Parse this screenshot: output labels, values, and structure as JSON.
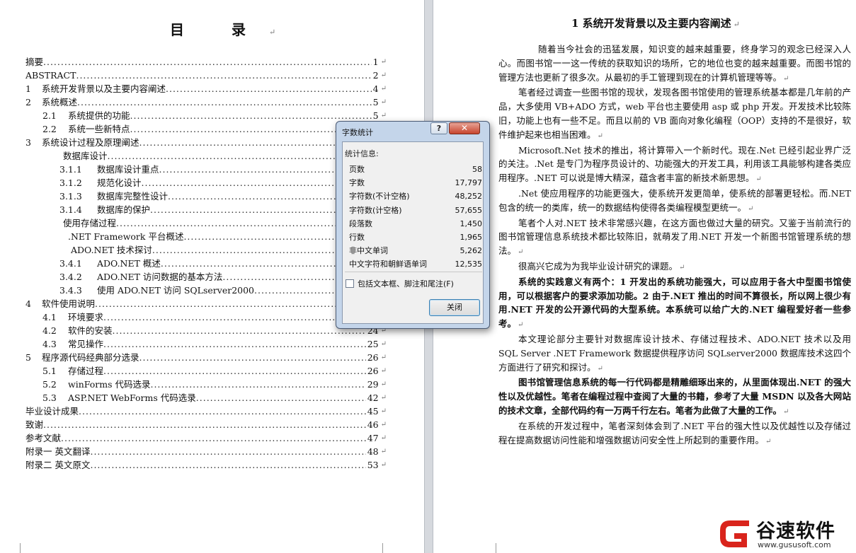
{
  "toc": {
    "title": "目 录",
    "entries": [
      {
        "num": "",
        "text": "摘要",
        "page": "1"
      },
      {
        "num": "",
        "text": "ABSTRACT",
        "page": "2"
      },
      {
        "num": "1",
        "text": "系统开发背景以及主要内容阐述",
        "page": "4"
      },
      {
        "num": "2",
        "text": "系统概述",
        "page": "5"
      },
      {
        "num": "2.1",
        "text": "系统提供的功能",
        "page": "5"
      },
      {
        "num": "2.2",
        "text": "系统一些新特点",
        "page": ""
      },
      {
        "num": "3",
        "text": "系统设计过程及原理阐述",
        "page": ""
      },
      {
        "num": "",
        "text": "数据库设计",
        "page": ""
      },
      {
        "num": "3.1.1",
        "text": "数据库设计重点",
        "page": ""
      },
      {
        "num": "3.1.2",
        "text": "规范化设计",
        "page": ""
      },
      {
        "num": "3.1.3",
        "text": "数据库完整性设计",
        "page": ""
      },
      {
        "num": "3.1.4",
        "text": "数据库的保护",
        "page": ""
      },
      {
        "num": "",
        "text": "使用存储过程",
        "page": ""
      },
      {
        "num": "",
        "text": ".NET Framework 平台概述",
        "page": ""
      },
      {
        "num": "",
        "text": "ADO.NET 技术探讨",
        "page": ""
      },
      {
        "num": "3.4.1",
        "text": "ADO.NET 概述",
        "page": ""
      },
      {
        "num": "3.4.2",
        "text": "ADO.NET 访问数据的基本方法",
        "page": ""
      },
      {
        "num": "3.4.3",
        "text": "使用 ADO.NET 访问 SQLserver2000",
        "page": ""
      },
      {
        "num": "4",
        "text": "软件使用说明",
        "page": ""
      },
      {
        "num": "4.1",
        "text": "环境要求",
        "page": ""
      },
      {
        "num": "4.2",
        "text": "软件的安装",
        "page": "24"
      },
      {
        "num": "4.3",
        "text": "常见操作",
        "page": "25"
      },
      {
        "num": "5",
        "text": "程序源代码经典部分选录",
        "page": "26"
      },
      {
        "num": "5.1",
        "text": "存储过程",
        "page": "26"
      },
      {
        "num": "5.2",
        "text": "winForms 代码选录",
        "page": "29"
      },
      {
        "num": "5.3",
        "text": "ASP.NET WebForms 代码选录",
        "page": "42"
      },
      {
        "num": "",
        "text": "毕业设计成果",
        "page": "45"
      },
      {
        "num": "",
        "text": "致谢",
        "page": "46"
      },
      {
        "num": "",
        "text": "参考文献",
        "page": "47"
      },
      {
        "num": "",
        "text": "附录一 英文翻译",
        "page": "48"
      },
      {
        "num": "",
        "text": "附录二 英文原文",
        "page": "53"
      }
    ]
  },
  "chapter": {
    "title": "1 系统开发背景以及主要内容阐述",
    "paragraphs": [
      {
        "text": "随着当今社会的迅猛发展，知识变的越来越重要，终身学习的观念已经深入人心。而图书馆一一这一传统的获取知识的场所，它的地位也变的越来越重要。而图书馆的管理方法也更新了很多次。从最初的手工管理到现在的计算机管理等等。",
        "bold": false
      },
      {
        "text": "笔者经过调查一些图书馆的现状，发现各图书馆使用的管理系统基本都是几年前的产品，大多使用 VB+ADO 方式，web 平台也主要使用 asp 或 php 开发。开发技术比较陈旧，功能上也有一些不足。而且以前的 VB 面向对象化编程（OOP）支持的不是很好，软件维护起来也相当困难。",
        "bold": false
      },
      {
        "text": "Microsoft.Net 技术的推出，将计算带入一个新时代。现在.Net 已经引起业界广泛的关注。.Net 是专门为程序员设计的、功能强大的开发工具，利用该工具能够构建各类应用程序。.NET 可以说是博大精深，蕴含者丰富的新技术新思想。",
        "bold": false
      },
      {
        "text": ".Net 使应用程序的功能更强大，使系统开发更简单，使系统的部署更轻松。而.NET 包含的统一的类库，统一的数据结构使得各类编程模型更统一。",
        "bold": false
      },
      {
        "text": "笔者个人对.NET 技术非常感兴趣，在这方面也做过大量的研究。又鉴于当前流行的图书馆管理信息系统技术都比较陈旧，就萌发了用.NET 开发一个新图书馆管理系统的想法。",
        "bold": false
      },
      {
        "text": "很高兴它成为为我毕业设计研究的课题。",
        "bold": false
      },
      {
        "text": "系统的实践意义有两个：1 开发出的系统功能强大，可以应用于各大中型图书馆使用，可以根据客户的要求添加功能。2 由于.NET 推出的时间不算很长，所以网上很少有用.NET 开发的公开源代码的大型系统。本系统可以给广大的.NET 编程爱好者一些参考。",
        "bold": true
      },
      {
        "text": "本文理论部分主要针对数据库设计技术、存储过程技术、ADO.NET 技术以及用 SQL Server .NET Framework 数据提供程序访问 SQLserver2000 数据库技术这四个方面进行了研究和探讨。",
        "bold": false
      },
      {
        "text": "图书馆管理信息系统的每一行代码都是精雕细琢出来的，从里面体现出.NET 的强大性以及优越性。笔者在编程过程中查阅了大量的书籍，参考了大量 MSDN 以及各大网站的技术文章，全部代码约有一万两千行左右。笔者为此做了大量的工作。",
        "bold": true
      },
      {
        "text": "在系统的开发过程中，笔者深刻体会到了.NET 平台的强大性以及优越性以及存储过程在提高数据访问性能和增强数据访问安全性上所起到的重要作用。",
        "bold": false
      }
    ]
  },
  "dialog": {
    "title": "字数统计",
    "help_label": "?",
    "close_x_label": "✕",
    "section_label": "统计信息:",
    "stats": [
      {
        "label": "页数",
        "value": "58"
      },
      {
        "label": "字数",
        "value": "17,797"
      },
      {
        "label": "字符数(不计空格)",
        "value": "48,252"
      },
      {
        "label": "字符数(计空格)",
        "value": "57,655"
      },
      {
        "label": "段落数",
        "value": "1,450"
      },
      {
        "label": "行数",
        "value": "1,965"
      },
      {
        "label": "非中文单词",
        "value": "5,262"
      },
      {
        "label": "中文字符和朝鲜语单词",
        "value": "12,535"
      }
    ],
    "checkbox_label": "包括文本框、脚注和尾注(F)",
    "checkbox_checked": false,
    "close_button_label": "关闭"
  },
  "watermark": {
    "name": "谷速软件",
    "url": "www.gususoft.com",
    "logo_color": "#d9241c"
  }
}
